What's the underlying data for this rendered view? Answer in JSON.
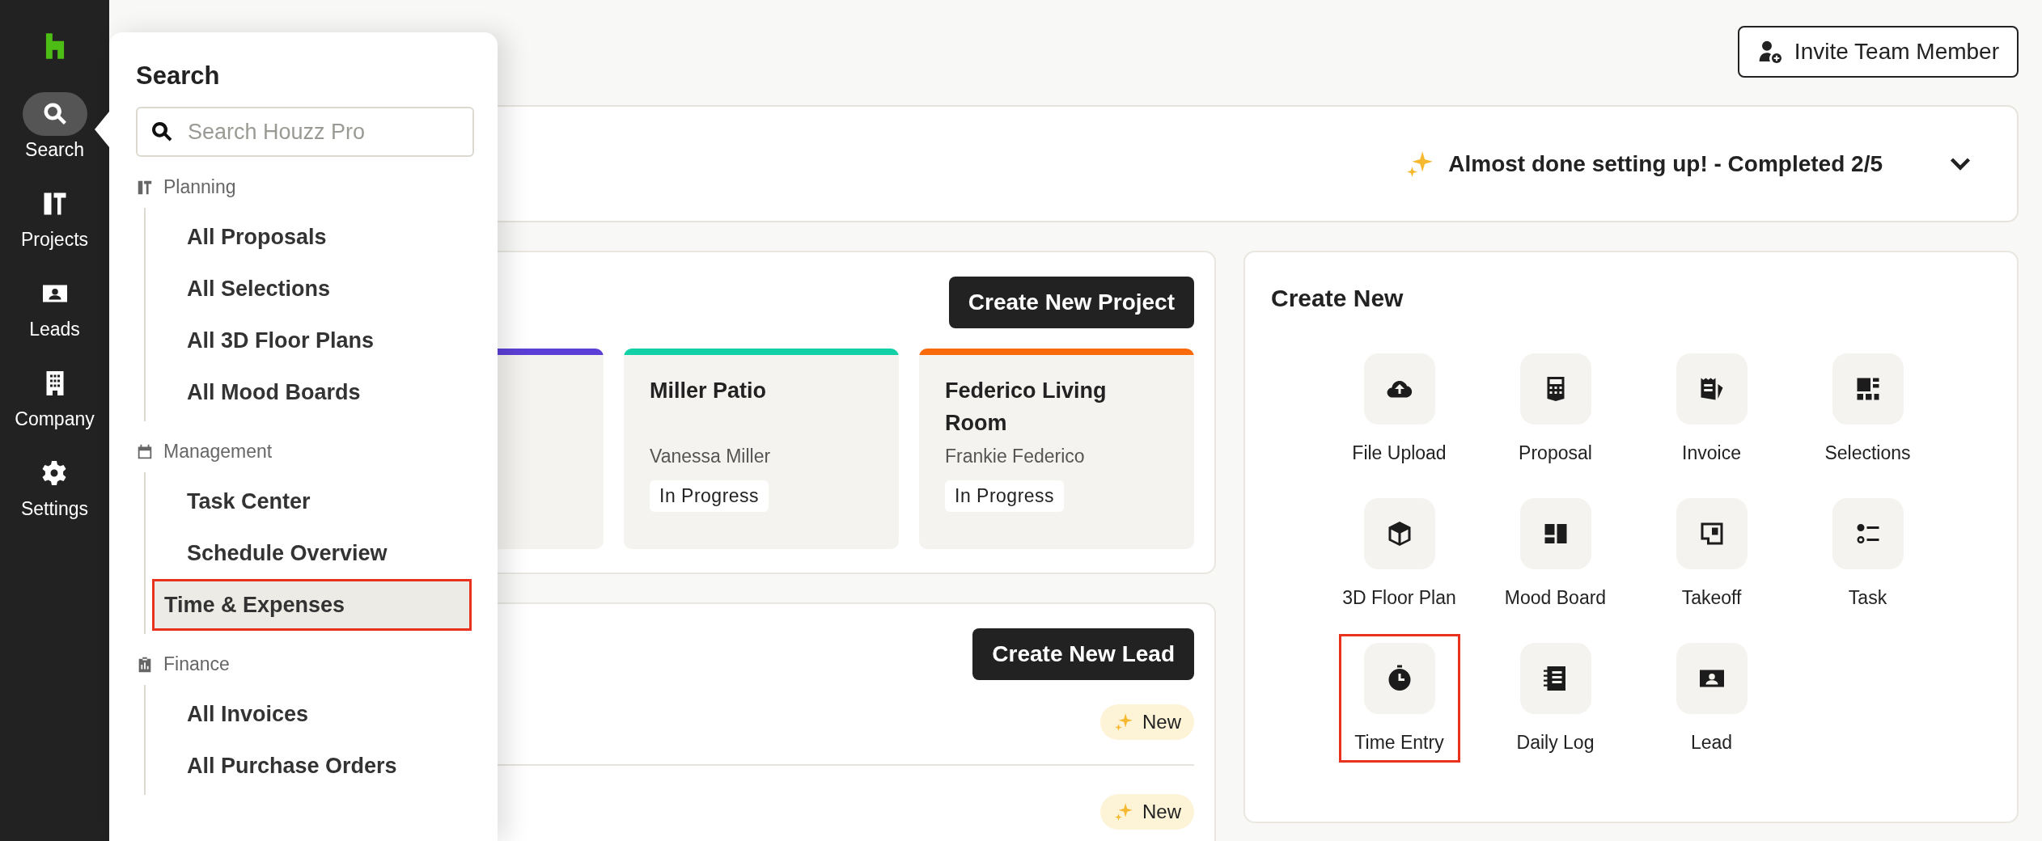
{
  "nav": [
    {
      "label": "Search",
      "selected": true
    },
    {
      "label": "Projects",
      "selected": false
    },
    {
      "label": "Leads",
      "selected": false
    },
    {
      "label": "Company",
      "selected": false
    },
    {
      "label": "Settings",
      "selected": false
    }
  ],
  "search_panel": {
    "title": "Search",
    "placeholder": "Search Houzz Pro",
    "sections": [
      {
        "label": "Planning",
        "items": [
          {
            "label": "All Proposals",
            "highlighted": false
          },
          {
            "label": "All Selections",
            "highlighted": false
          },
          {
            "label": "All 3D Floor Plans",
            "highlighted": false
          },
          {
            "label": "All Mood Boards",
            "highlighted": false
          }
        ]
      },
      {
        "label": "Management",
        "items": [
          {
            "label": "Task Center",
            "highlighted": false
          },
          {
            "label": "Schedule Overview",
            "highlighted": false
          },
          {
            "label": "Time & Expenses",
            "highlighted": true
          }
        ]
      },
      {
        "label": "Finance",
        "items": [
          {
            "label": "All Invoices",
            "highlighted": false
          },
          {
            "label": "All Purchase Orders",
            "highlighted": false
          }
        ]
      }
    ]
  },
  "header": {
    "invite_button": "Invite Team Member"
  },
  "setup_banner": {
    "text": "Almost done setting up! - Completed 2/5"
  },
  "projects": {
    "button": "Create New Project",
    "cards": [
      {
        "color": "#5b3fd6"
      },
      {
        "color": "#12d1a6",
        "title": "Miller Patio",
        "client": "Vanessa Miller",
        "status": "In Progress"
      },
      {
        "color": "#fa6a0a",
        "title": "Federico Living Room",
        "client": "Frankie Federico",
        "status": "In Progress"
      }
    ]
  },
  "leads": {
    "button": "Create New Lead",
    "rows": [
      {
        "badge": "New"
      },
      {
        "badge": "New"
      }
    ]
  },
  "create_new": {
    "title": "Create New",
    "tiles": [
      {
        "label": "File Upload",
        "highlighted": false
      },
      {
        "label": "Proposal",
        "highlighted": false
      },
      {
        "label": "Invoice",
        "highlighted": false
      },
      {
        "label": "Selections",
        "highlighted": false
      },
      {
        "label": "3D Floor Plan",
        "highlighted": false
      },
      {
        "label": "Mood Board",
        "highlighted": false
      },
      {
        "label": "Takeoff",
        "highlighted": false
      },
      {
        "label": "Task",
        "highlighted": false
      },
      {
        "label": "Time Entry",
        "highlighted": true
      },
      {
        "label": "Daily Log",
        "highlighted": false
      },
      {
        "label": "Lead",
        "highlighted": false
      }
    ]
  }
}
